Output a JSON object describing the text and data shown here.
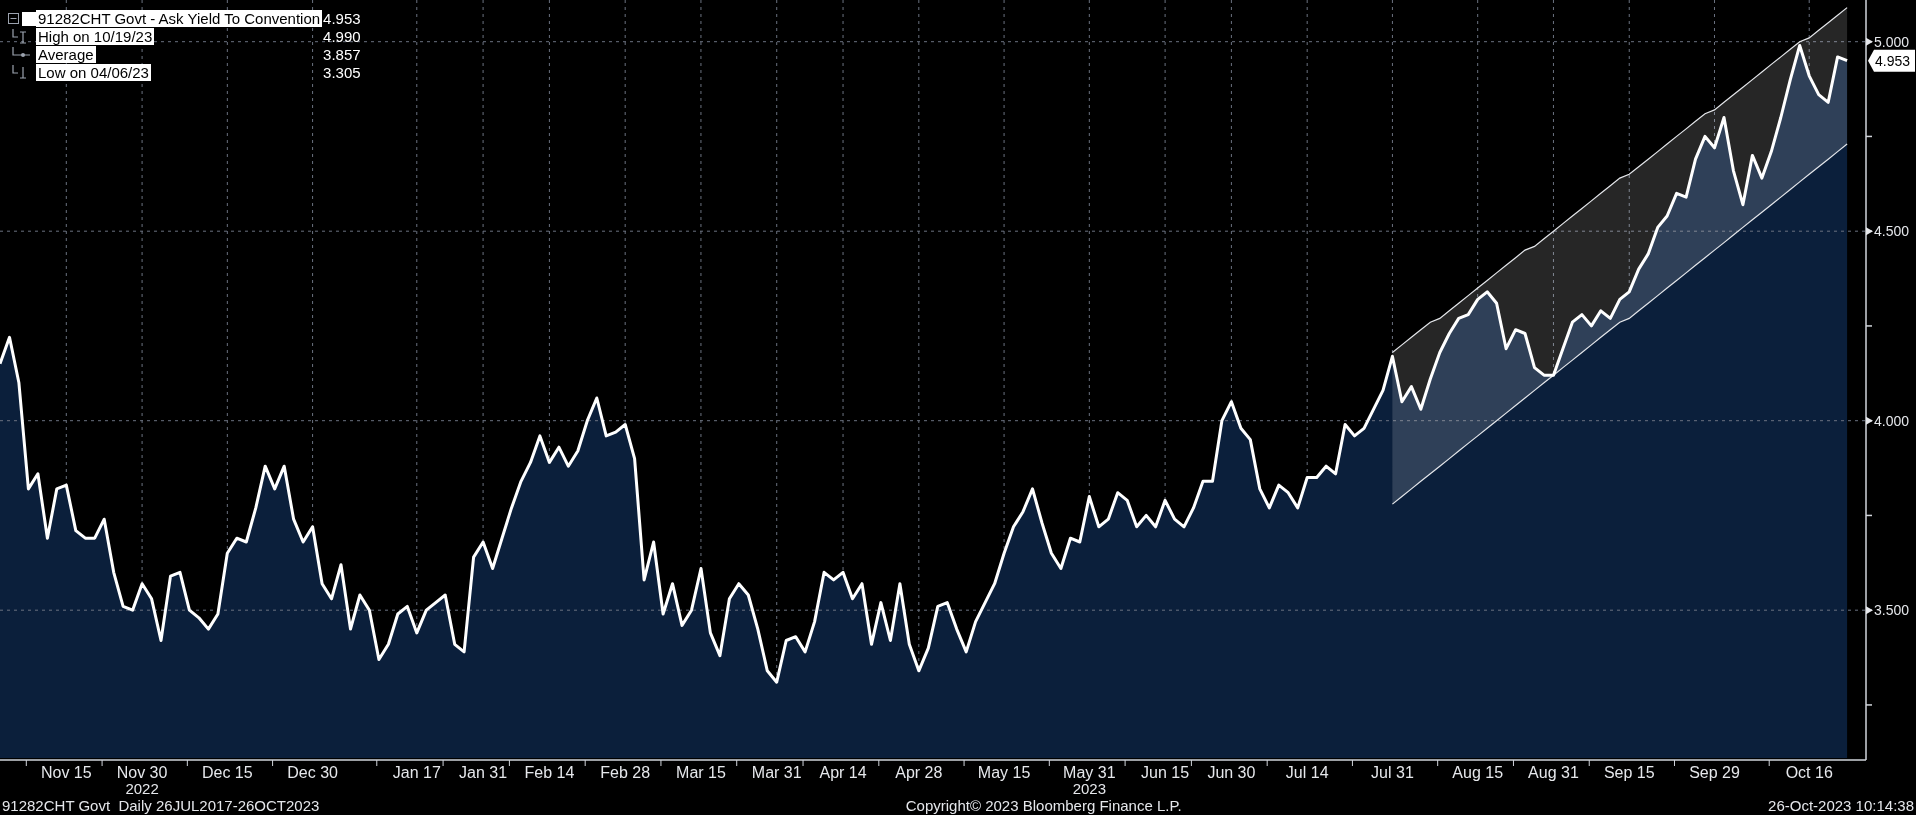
{
  "legend": {
    "series_value": "4.953",
    "items": [
      {
        "kind": "high",
        "label": "High on 10/19/23",
        "value": "4.990"
      },
      {
        "kind": "average",
        "label": "Average",
        "value": "3.857"
      },
      {
        "kind": "low",
        "label": "Low on 04/06/23",
        "value": "3.305"
      }
    ]
  },
  "chart": {
    "last_value": "4.953",
    "years": [
      "2022",
      "2023"
    ],
    "chart_data": {
      "type": "area",
      "grid": true,
      "ylim": [
        3.11,
        5.11
      ],
      "yticks": [
        {
          "value": 3.5,
          "label": "3.500"
        },
        {
          "value": 4,
          "label": "4.000"
        },
        {
          "value": 4.5,
          "label": "4.500"
        },
        {
          "value": 5,
          "label": "5.000"
        }
      ],
      "categories": [
        null,
        null,
        null,
        null,
        null,
        null,
        null,
        "Nov 15",
        null,
        null,
        null,
        null,
        null,
        null,
        null,
        "Nov 30",
        null,
        null,
        null,
        null,
        null,
        null,
        null,
        null,
        "Dec 15",
        null,
        null,
        null,
        null,
        null,
        null,
        null,
        null,
        "Dec 30",
        null,
        null,
        null,
        null,
        null,
        null,
        null,
        null,
        null,
        null,
        "Jan 17",
        null,
        null,
        null,
        null,
        null,
        null,
        "Jan 31",
        null,
        null,
        null,
        null,
        null,
        null,
        "Feb 14",
        null,
        null,
        null,
        null,
        null,
        null,
        null,
        "Feb 28",
        null,
        null,
        null,
        null,
        null,
        null,
        null,
        "Mar 15",
        null,
        null,
        null,
        null,
        null,
        null,
        null,
        "Mar 31",
        null,
        null,
        null,
        null,
        null,
        null,
        "Apr 14",
        null,
        null,
        null,
        null,
        null,
        null,
        null,
        "Apr 28",
        null,
        null,
        null,
        null,
        null,
        null,
        null,
        null,
        "May 15",
        null,
        null,
        null,
        null,
        null,
        null,
        null,
        null,
        "May 31",
        null,
        null,
        null,
        null,
        null,
        null,
        null,
        "Jun 15",
        null,
        null,
        null,
        null,
        null,
        null,
        "Jun 30",
        null,
        null,
        null,
        null,
        null,
        null,
        null,
        "Jul 14",
        null,
        null,
        null,
        null,
        null,
        null,
        null,
        null,
        "Jul 31",
        null,
        null,
        null,
        null,
        null,
        null,
        null,
        null,
        "Aug 15",
        null,
        null,
        null,
        null,
        null,
        null,
        null,
        "Aug 31",
        null,
        null,
        null,
        null,
        null,
        null,
        null,
        "Sep 15",
        null,
        null,
        null,
        null,
        null,
        null,
        null,
        null,
        "Sep 29",
        null,
        null,
        null,
        null,
        null,
        null,
        null,
        null,
        null,
        "Oct 16",
        null,
        null,
        null,
        null
      ],
      "series": [
        {
          "name": "91282CHT Govt - Ask Yield To Convention",
          "color": "#ffffff",
          "values": [
            4.15,
            4.22,
            4.1,
            3.82,
            3.86,
            3.69,
            3.82,
            3.83,
            3.71,
            3.69,
            3.69,
            3.74,
            3.6,
            3.51,
            3.5,
            3.57,
            3.53,
            3.42,
            3.59,
            3.6,
            3.5,
            3.48,
            3.45,
            3.49,
            3.65,
            3.69,
            3.68,
            3.77,
            3.88,
            3.82,
            3.88,
            3.74,
            3.68,
            3.72,
            3.57,
            3.53,
            3.62,
            3.45,
            3.54,
            3.5,
            3.37,
            3.41,
            3.49,
            3.51,
            3.44,
            3.5,
            3.52,
            3.54,
            3.41,
            3.39,
            3.64,
            3.68,
            3.61,
            3.69,
            3.77,
            3.84,
            3.89,
            3.96,
            3.89,
            3.93,
            3.88,
            3.92,
            4.0,
            4.06,
            3.96,
            3.97,
            3.99,
            3.9,
            3.58,
            3.68,
            3.49,
            3.57,
            3.46,
            3.5,
            3.61,
            3.44,
            3.38,
            3.53,
            3.57,
            3.54,
            3.45,
            3.34,
            3.31,
            3.42,
            3.43,
            3.39,
            3.47,
            3.6,
            3.58,
            3.6,
            3.53,
            3.57,
            3.41,
            3.52,
            3.42,
            3.57,
            3.41,
            3.34,
            3.4,
            3.51,
            3.52,
            3.45,
            3.39,
            3.47,
            3.52,
            3.57,
            3.65,
            3.72,
            3.76,
            3.82,
            3.73,
            3.65,
            3.61,
            3.69,
            3.68,
            3.8,
            3.72,
            3.74,
            3.81,
            3.79,
            3.72,
            3.75,
            3.72,
            3.79,
            3.74,
            3.72,
            3.77,
            3.84,
            3.84,
            4.0,
            4.05,
            3.98,
            3.95,
            3.82,
            3.77,
            3.83,
            3.81,
            3.77,
            3.85,
            3.85,
            3.88,
            3.86,
            3.99,
            3.96,
            3.98,
            4.03,
            4.08,
            4.17,
            4.05,
            4.09,
            4.03,
            4.11,
            4.18,
            4.23,
            4.27,
            4.28,
            4.32,
            4.34,
            4.31,
            4.19,
            4.24,
            4.23,
            4.14,
            4.12,
            4.12,
            4.19,
            4.26,
            4.28,
            4.25,
            4.29,
            4.27,
            4.32,
            4.34,
            4.4,
            4.44,
            4.51,
            4.54,
            4.6,
            4.59,
            4.69,
            4.75,
            4.72,
            4.8,
            4.66,
            4.57,
            4.7,
            4.64,
            4.71,
            4.8,
            4.9,
            4.99,
            4.91,
            4.86,
            4.84,
            4.96,
            4.95
          ]
        },
        {
          "type": "line",
          "color": "#e5e7eb",
          "values": [
            null,
            null,
            null,
            null,
            null,
            null,
            null,
            null,
            null,
            null,
            null,
            null,
            null,
            null,
            null,
            null,
            null,
            null,
            null,
            null,
            null,
            null,
            null,
            null,
            null,
            null,
            null,
            null,
            null,
            null,
            null,
            null,
            null,
            null,
            null,
            null,
            null,
            null,
            null,
            null,
            null,
            null,
            null,
            null,
            null,
            null,
            null,
            null,
            null,
            null,
            null,
            null,
            null,
            null,
            null,
            null,
            null,
            null,
            null,
            null,
            null,
            null,
            null,
            null,
            null,
            null,
            null,
            null,
            null,
            null,
            null,
            null,
            null,
            null,
            null,
            null,
            null,
            null,
            null,
            null,
            null,
            null,
            null,
            null,
            null,
            null,
            null,
            null,
            null,
            null,
            null,
            null,
            null,
            null,
            null,
            null,
            null,
            null,
            null,
            null,
            null,
            null,
            null,
            null,
            null,
            null,
            null,
            null,
            null,
            null,
            null,
            null,
            null,
            null,
            null,
            null,
            null,
            null,
            null,
            null,
            null,
            null,
            null,
            null,
            null,
            null,
            null,
            null,
            null,
            null,
            null,
            null,
            null,
            null,
            null,
            null,
            null,
            null,
            null,
            null,
            null,
            null,
            null,
            null,
            null,
            null,
            null,
            4.18,
            4.2,
            4.22,
            4.24,
            4.26,
            4.27,
            4.29,
            4.31,
            4.33,
            4.35,
            4.37,
            4.39,
            4.41,
            4.43,
            4.45,
            4.46,
            4.48,
            4.5,
            4.52,
            4.54,
            4.56,
            4.58,
            4.6,
            4.62,
            4.64,
            4.65,
            4.67,
            4.69,
            4.71,
            4.73,
            4.75,
            4.77,
            4.79,
            4.81,
            4.82,
            4.84,
            4.86,
            4.88,
            4.9,
            4.92,
            4.94,
            4.96,
            4.98,
            5.0,
            5.01,
            5.03,
            5.05,
            5.07,
            5.09
          ]
        },
        {
          "type": "line",
          "color": "#e5e7eb",
          "values": [
            null,
            null,
            null,
            null,
            null,
            null,
            null,
            null,
            null,
            null,
            null,
            null,
            null,
            null,
            null,
            null,
            null,
            null,
            null,
            null,
            null,
            null,
            null,
            null,
            null,
            null,
            null,
            null,
            null,
            null,
            null,
            null,
            null,
            null,
            null,
            null,
            null,
            null,
            null,
            null,
            null,
            null,
            null,
            null,
            null,
            null,
            null,
            null,
            null,
            null,
            null,
            null,
            null,
            null,
            null,
            null,
            null,
            null,
            null,
            null,
            null,
            null,
            null,
            null,
            null,
            null,
            null,
            null,
            null,
            null,
            null,
            null,
            null,
            null,
            null,
            null,
            null,
            null,
            null,
            null,
            null,
            null,
            null,
            null,
            null,
            null,
            null,
            null,
            null,
            null,
            null,
            null,
            null,
            null,
            null,
            null,
            null,
            null,
            null,
            null,
            null,
            null,
            null,
            null,
            null,
            null,
            null,
            null,
            null,
            null,
            null,
            null,
            null,
            null,
            null,
            null,
            null,
            null,
            null,
            null,
            null,
            null,
            null,
            null,
            null,
            null,
            null,
            null,
            null,
            null,
            null,
            null,
            null,
            null,
            null,
            null,
            null,
            null,
            null,
            null,
            null,
            null,
            null,
            null,
            null,
            null,
            null,
            3.78,
            3.8,
            3.82,
            3.84,
            3.86,
            3.88,
            3.9,
            3.92,
            3.94,
            3.96,
            3.98,
            4.0,
            4.02,
            4.04,
            4.06,
            4.08,
            4.1,
            4.12,
            4.14,
            4.16,
            4.18,
            4.2,
            4.22,
            4.24,
            4.26,
            4.27,
            4.29,
            4.31,
            4.33,
            4.35,
            4.37,
            4.39,
            4.41,
            4.43,
            4.45,
            4.47,
            4.49,
            4.51,
            4.53,
            4.55,
            4.57,
            4.59,
            4.61,
            4.63,
            4.65,
            4.67,
            4.69,
            4.71,
            4.73
          ]
        }
      ]
    }
  },
  "footer": {
    "left": "91282CHT Govt  Daily 26JUL2017-26OCT2023",
    "center": "Copyright© 2023 Bloomberg Finance L.P.",
    "right": "26-Oct-2023 10:14:38"
  }
}
